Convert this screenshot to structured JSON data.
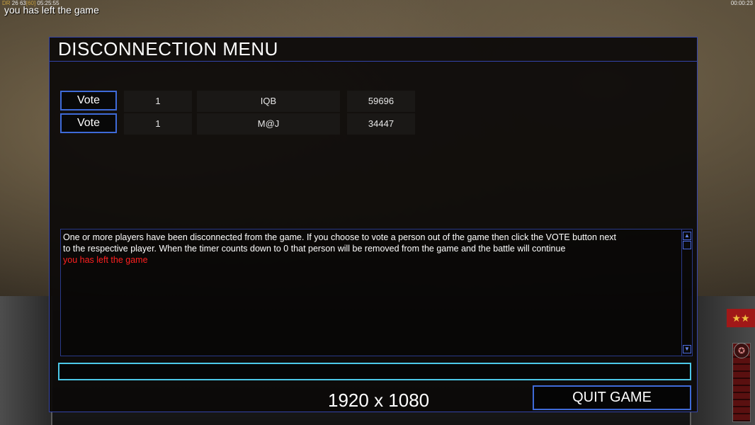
{
  "hud": {
    "stats_prefix": "DR",
    "stats_a": "26",
    "stats_b": "63",
    "stats_c": "[60]",
    "stats_time": "05:25:55",
    "message": "you has left the game",
    "clock": "00:00:23"
  },
  "panel": {
    "title": "DISCONNECTION MENU",
    "players": [
      {
        "vote_label": "Vote",
        "slot": "1",
        "name": "IQB",
        "ping": "59696"
      },
      {
        "vote_label": "Vote",
        "slot": "1",
        "name": "M@J",
        "ping": "34447"
      }
    ],
    "message_lines": [
      "One or more players have been disconnected from the game. If you choose to vote a person out of the game then click the VOTE button next",
      " to the respective player. When the timer counts down to 0 that person will be removed from the game and the battle will continue"
    ],
    "alert_line": "you has left the game",
    "chat_value": "",
    "resolution_label": "1920 x 1080",
    "quit_label": "QUIT GAME"
  },
  "colors": {
    "panel_border": "#3344aa",
    "button_border": "#3f6bd8",
    "input_border": "#4cc8e8",
    "alert": "#ff2020"
  },
  "icons": [
    "scroll-up-arrow-icon",
    "scroll-down-arrow-icon",
    "rank-stars-icon",
    "radar-star-icon"
  ]
}
